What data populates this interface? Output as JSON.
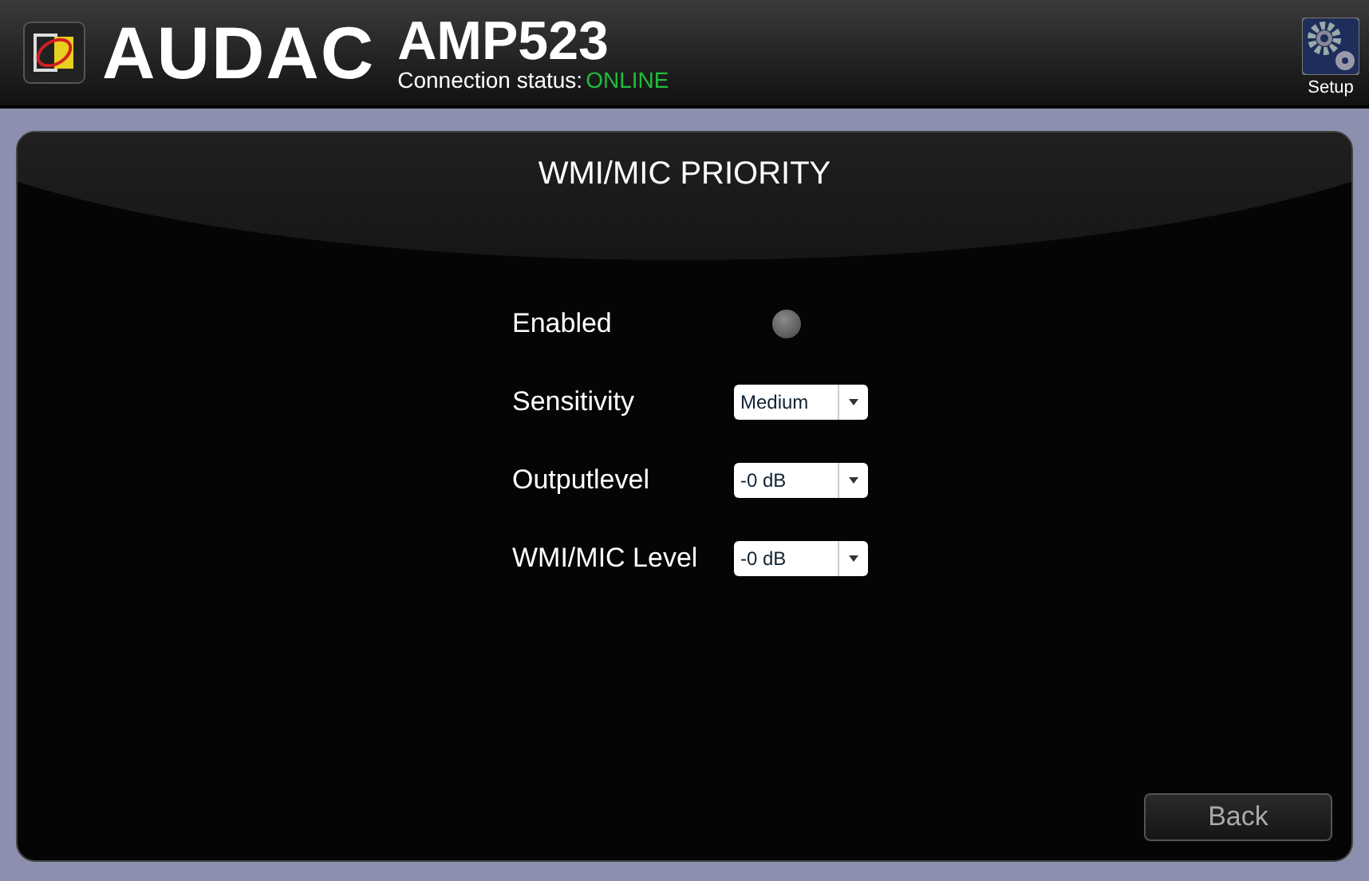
{
  "header": {
    "brand": "AUDAC",
    "model": "AMP523",
    "status_label": "Connection status:",
    "status_value": "ONLINE",
    "setup_label": "Setup"
  },
  "panel": {
    "title": "WMI/MIC PRIORITY",
    "settings": [
      {
        "kind": "led",
        "label": "Enabled",
        "on": false
      },
      {
        "kind": "select",
        "label": "Sensitivity",
        "value": "Medium"
      },
      {
        "kind": "select",
        "label": "Outputlevel",
        "value": "-0 dB"
      },
      {
        "kind": "select",
        "label": "WMI/MIC Level",
        "value": "-0 dB"
      }
    ],
    "back_label": "Back"
  }
}
